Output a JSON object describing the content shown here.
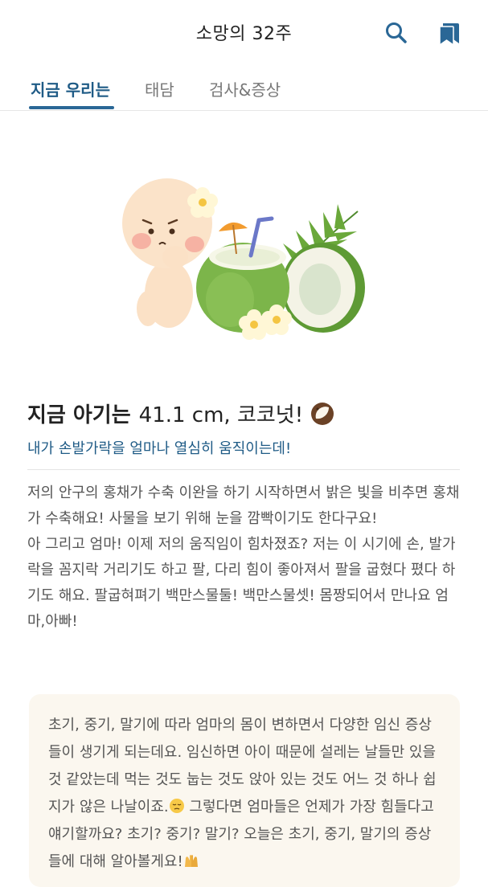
{
  "header": {
    "title": "소망의 32주",
    "search_icon": "search-icon",
    "bookmark_icon": "bookmark-icon",
    "accent_color": "#2a6796"
  },
  "tabs": [
    {
      "label": "지금 우리는",
      "active": true
    },
    {
      "label": "태담",
      "active": false
    },
    {
      "label": "검사&증상",
      "active": false
    }
  ],
  "baby": {
    "lead": "지금 아기는",
    "size": "41.1 cm, 코코넛!",
    "size_icon": "coconut-icon",
    "subtitle": "내가 손발가락을 얼마나 열심히 움직이는데!"
  },
  "description": [
    "저의 안구의 홍채가 수축 이완을 하기 시작하면서 밝은 빛을 비추면 홍채가 수축해요! 사물을 보기 위해 눈을 깜빡이기도 한다구요!",
    "아 그리고 엄마! 이제 저의 움직임이 힘차졌죠? 저는 이 시기에 손, 발가락을 꼼지락 거리기도 하고 팔, 다리 힘이 좋아져서 팔을 굽혔다 폈다 하기도 해요. 팔굽혀펴기 백만스물둘! 백만스물셋! 몸짱되어서 만나요 엄마,아빠!"
  ],
  "info_card": {
    "text_a": "초기, 중기, 말기에 따라 엄마의 몸이 변하면서 다양한 임신 증상들이 생기게 되는데요. 임신하면 아이 때문에 설레는 날들만 있을 것 같았는데 먹는 것도 눕는 것도 앉아 있는 것도 어느 것 하나 쉽지가 않은 나날이죠.",
    "text_b": " 그렇다면 엄마들은 언제가 가장 힘들다고 얘기할까요? 초기? 중기? 말기? 오늘은 초기, 중기, 말기의 증상들에 대해 알아볼게요!",
    "icon_a": "pensive-face-icon",
    "icon_b": "raised-hands-icon",
    "background": "#fbf7ef"
  }
}
